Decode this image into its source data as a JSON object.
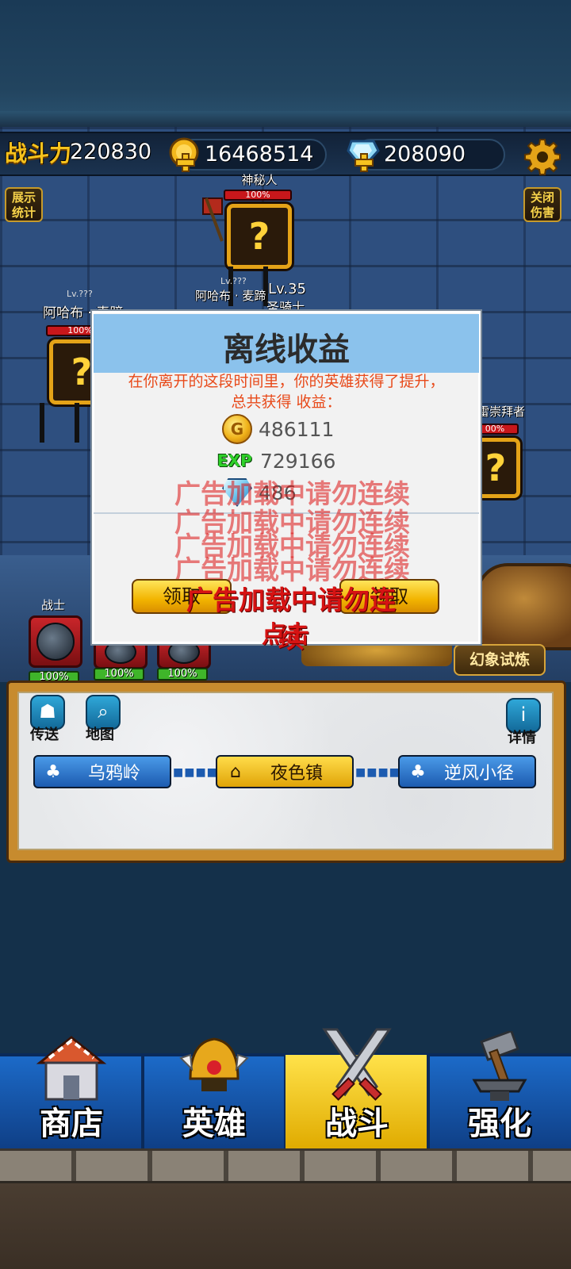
{
  "header": {
    "power_label": "战斗力",
    "power_value": "220830",
    "gold": "16468514",
    "gems": "208090"
  },
  "side_buttons": {
    "left_label": "展示\n统计",
    "right_label": "关闭\n伤害"
  },
  "enemies": [
    {
      "name": "神秘人",
      "hp": "100%"
    },
    {
      "lv": "Lv.???",
      "name": "阿哈布 · 麦蹄",
      "extra": "Lv.35",
      "extra2": "圣骑士"
    },
    {
      "lv": "Lv.???",
      "name": "阿哈布 · 麦蹄",
      "hp": "100%"
    },
    {
      "name": "雷崇拜者",
      "hp": "00%"
    }
  ],
  "dialog": {
    "title": "离线收益",
    "desc_line1": "在你离开的这段时间里，你的英雄获得了提升，",
    "desc_line2": "总共获得 收益：",
    "gold_reward": "486111",
    "exp_label": "EXP",
    "exp_reward": "729166",
    "gem_reward": "486",
    "claim_left": "领取",
    "claim_right": "领取",
    "ad_overlay": "广告加载中请勿连续",
    "ad_click": "点击"
  },
  "heroes": {
    "label": "战士",
    "slots": [
      {
        "hp": "100%"
      },
      {
        "hp": "100%"
      },
      {
        "hp": "100%"
      }
    ],
    "trial_button": "幻象试炼"
  },
  "map": {
    "teleport": "传送",
    "map": "地图",
    "details": "详情",
    "locations": [
      "乌鸦岭",
      "夜色镇",
      "逆风小径"
    ],
    "current": 1
  },
  "nav": {
    "tabs": [
      "商店",
      "英雄",
      "战斗",
      "强化"
    ],
    "active": 2
  },
  "colors": {
    "gold_accent": "#f6c21c",
    "dialog_title_bar": "#8bc2ec",
    "desc_text": "#e84a1a",
    "ad_red": "#d61313"
  }
}
